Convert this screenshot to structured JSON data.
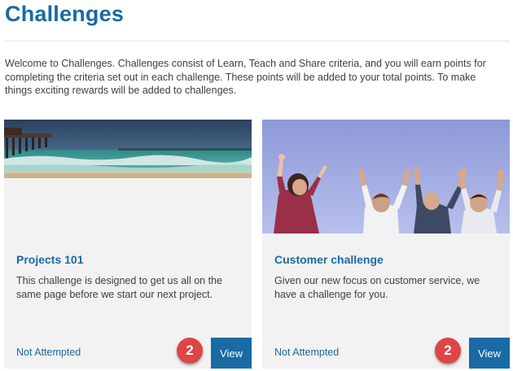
{
  "page": {
    "title": "Challenges",
    "intro": "Welcome to Challenges. Challenges consist of Learn, Teach and Share criteria, and you will earn points for completing the criteria set out in each challenge. These points will be added to your total points. To make things exciting rewards will be added to challenges."
  },
  "colors": {
    "accent": "#1a6aa3",
    "card_background": "#f2f2f2",
    "badge": "#e04545"
  },
  "cards": [
    {
      "title": "Projects 101",
      "description": "This challenge is designed to get us all on the same page before we start our next project.",
      "status": "Not Attempted",
      "button_label": "View",
      "badge": "2",
      "image": "pier-ocean-photo"
    },
    {
      "title": "Customer challenge",
      "description": "Given our new focus on customer service, we have a challenge for you.",
      "status": "Not Attempted",
      "button_label": "View",
      "badge": "2",
      "image": "people-raising-hands-photo"
    }
  ]
}
